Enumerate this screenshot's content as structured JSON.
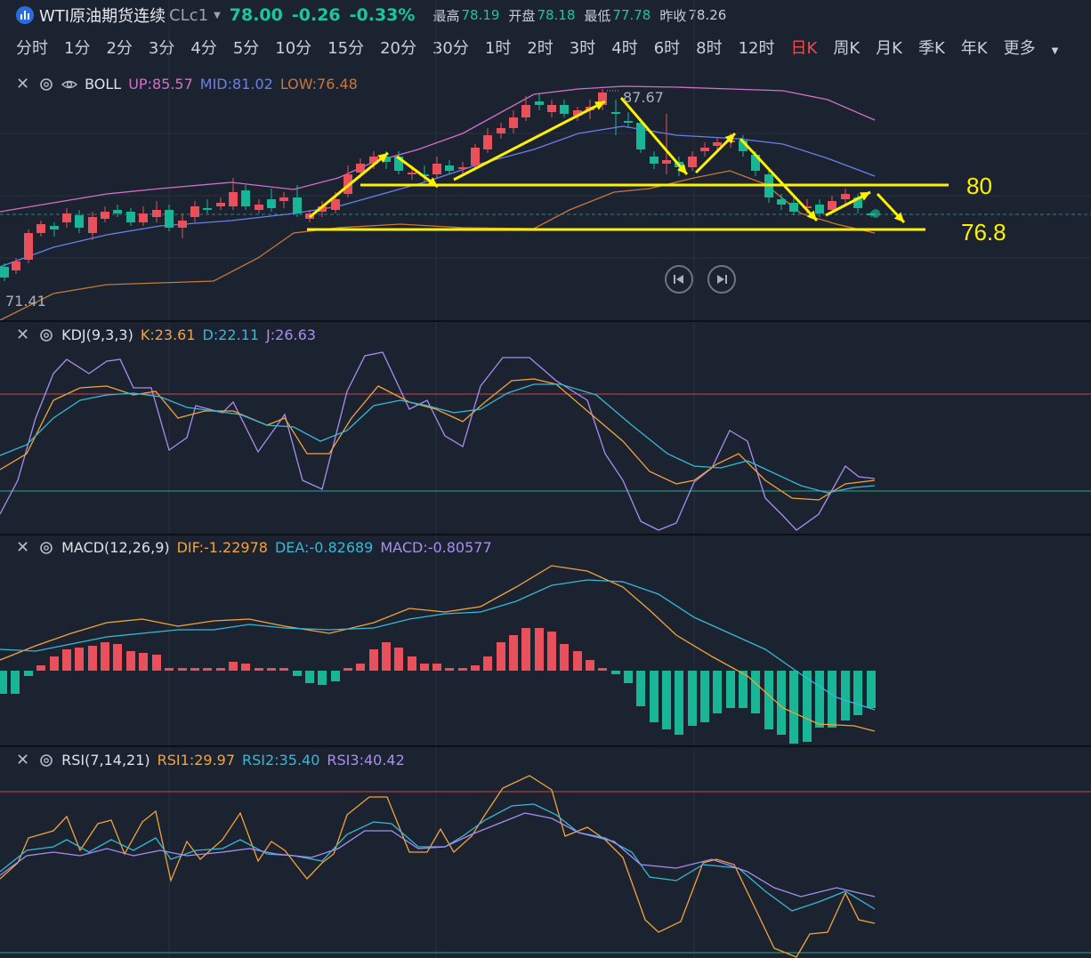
{
  "header": {
    "name": "WTI原油期货连续",
    "code": "CLc1",
    "last_price": "78.00",
    "change": "-0.26",
    "change_pct": "-0.33%",
    "high_label": "最高",
    "high": "78.19",
    "open_label": "开盘",
    "open": "78.18",
    "low_label": "最低",
    "low": "77.78",
    "prev_close_label": "昨收",
    "prev_close": "78.26"
  },
  "timeframes": [
    "分时",
    "1分",
    "2分",
    "3分",
    "4分",
    "5分",
    "10分",
    "15分",
    "20分",
    "30分",
    "1时",
    "2时",
    "3时",
    "4时",
    "6时",
    "8时",
    "12时",
    "日K",
    "周K",
    "月K",
    "季K",
    "年K",
    "更多"
  ],
  "active_timeframe": "日K",
  "boll": {
    "name": "BOLL",
    "up": "UP:85.57",
    "mid": "MID:81.02",
    "low": "LOW:76.48",
    "max_marker": "87.67",
    "min_marker": "71.41",
    "colors": {
      "up": "#d36fc8",
      "mid": "#6b7fe8",
      "low": "#c6773a"
    }
  },
  "annotations": {
    "upper_level": "80",
    "lower_level": "76.8"
  },
  "kdj": {
    "name": "KDJ(9,3,3)",
    "k": "K:23.61",
    "d": "D:22.11",
    "j": "J:26.63"
  },
  "macd": {
    "name": "MACD(12,26,9)",
    "dif": "DIF:-1.22978",
    "dea": "DEA:-0.82689",
    "macd": "MACD:-0.80577"
  },
  "rsi": {
    "name": "RSI(7,14,21)",
    "rsi1": "RSI1:29.97",
    "rsi2": "RSI2:35.40",
    "rsi3": "RSI3:40.42"
  },
  "colors": {
    "up": "#e8505b",
    "down": "#19b597",
    "annot": "#fff200",
    "line_orange": "#f2a33b",
    "line_cyan": "#36b8d6",
    "line_purple": "#a98df0"
  }
}
